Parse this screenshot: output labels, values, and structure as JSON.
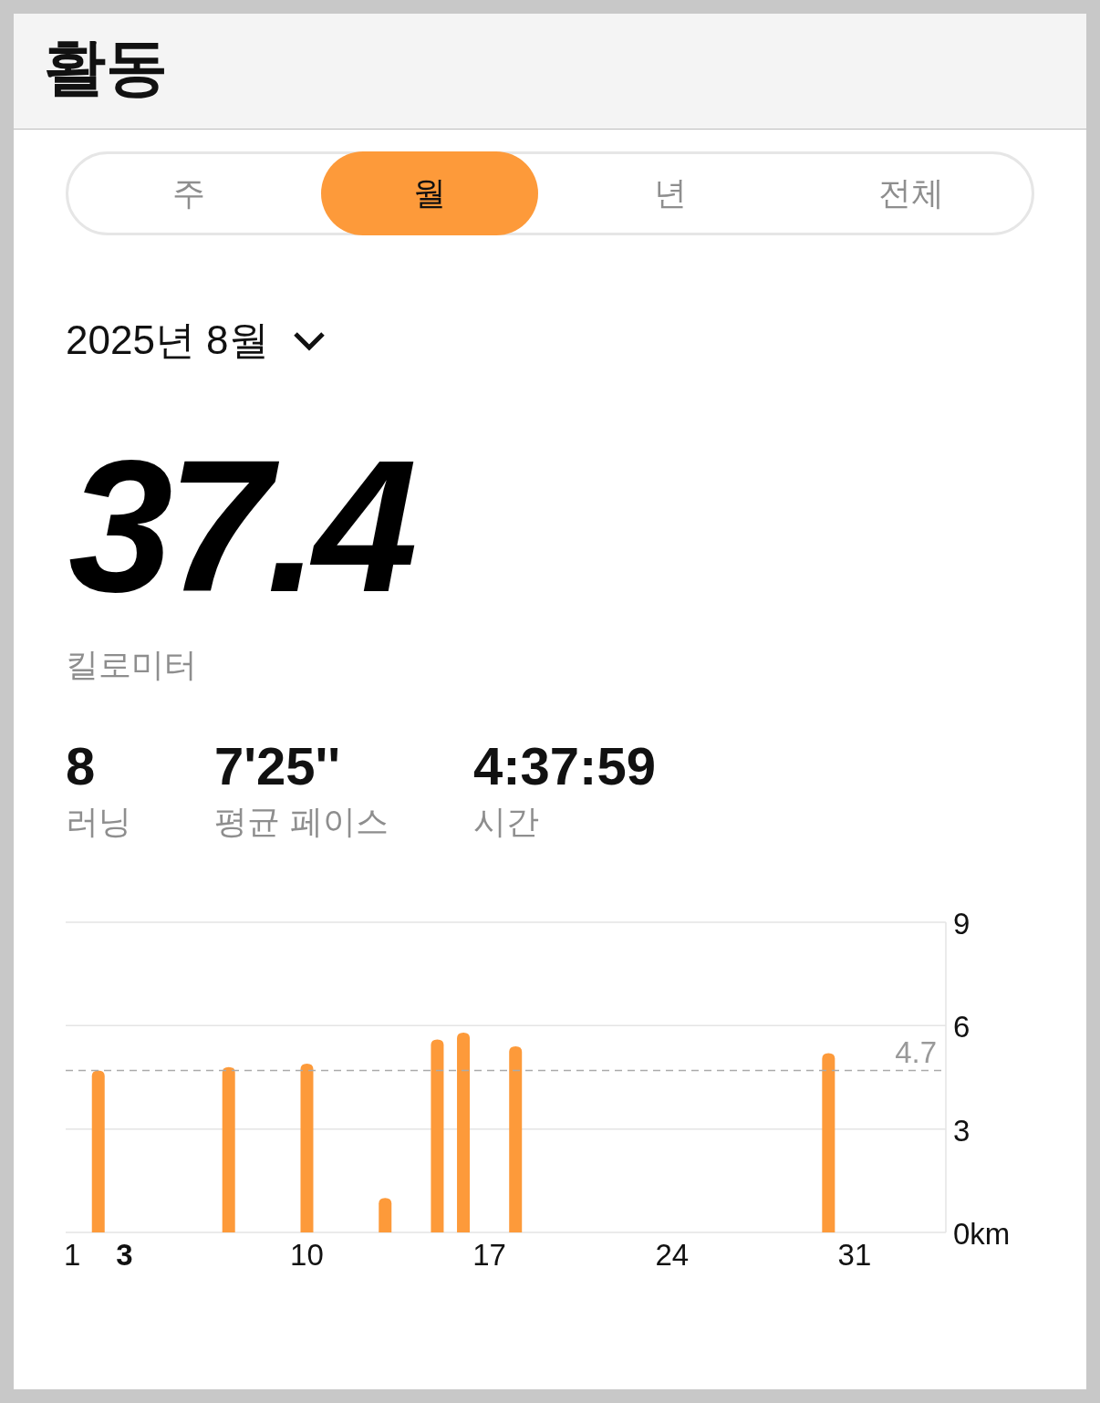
{
  "header": {
    "title": "활동"
  },
  "tabs": [
    {
      "label": "주",
      "selected": false
    },
    {
      "label": "월",
      "selected": true
    },
    {
      "label": "년",
      "selected": false
    },
    {
      "label": "전체",
      "selected": false
    }
  ],
  "period": {
    "label": "2025년 8월"
  },
  "total": {
    "value": "37.4",
    "unit": "킬로미터"
  },
  "stats": [
    {
      "value": "8",
      "label": "러닝"
    },
    {
      "value": "7'25''",
      "label": "평균 페이스"
    },
    {
      "value": "4:37:59",
      "label": "시간"
    }
  ],
  "chart": {
    "xtick_selected": [
      false,
      true,
      false,
      false,
      false,
      false
    ],
    "chart_data": {
      "type": "bar",
      "x": [
        2,
        7,
        10,
        13,
        15,
        16,
        18,
        30
      ],
      "values": [
        4.7,
        4.8,
        4.9,
        1.0,
        5.6,
        5.8,
        5.4,
        5.2
      ],
      "xlim": [
        0.75,
        34.5
      ],
      "ylim": [
        0,
        9
      ],
      "xticks": [
        1,
        3,
        10,
        17,
        24,
        31
      ],
      "yticks": [
        {
          "value": 0,
          "label": "0km"
        },
        3,
        6,
        9
      ],
      "ref_lines": [
        {
          "axis": "y",
          "value": 4.7,
          "label": "4.7"
        }
      ]
    }
  }
}
